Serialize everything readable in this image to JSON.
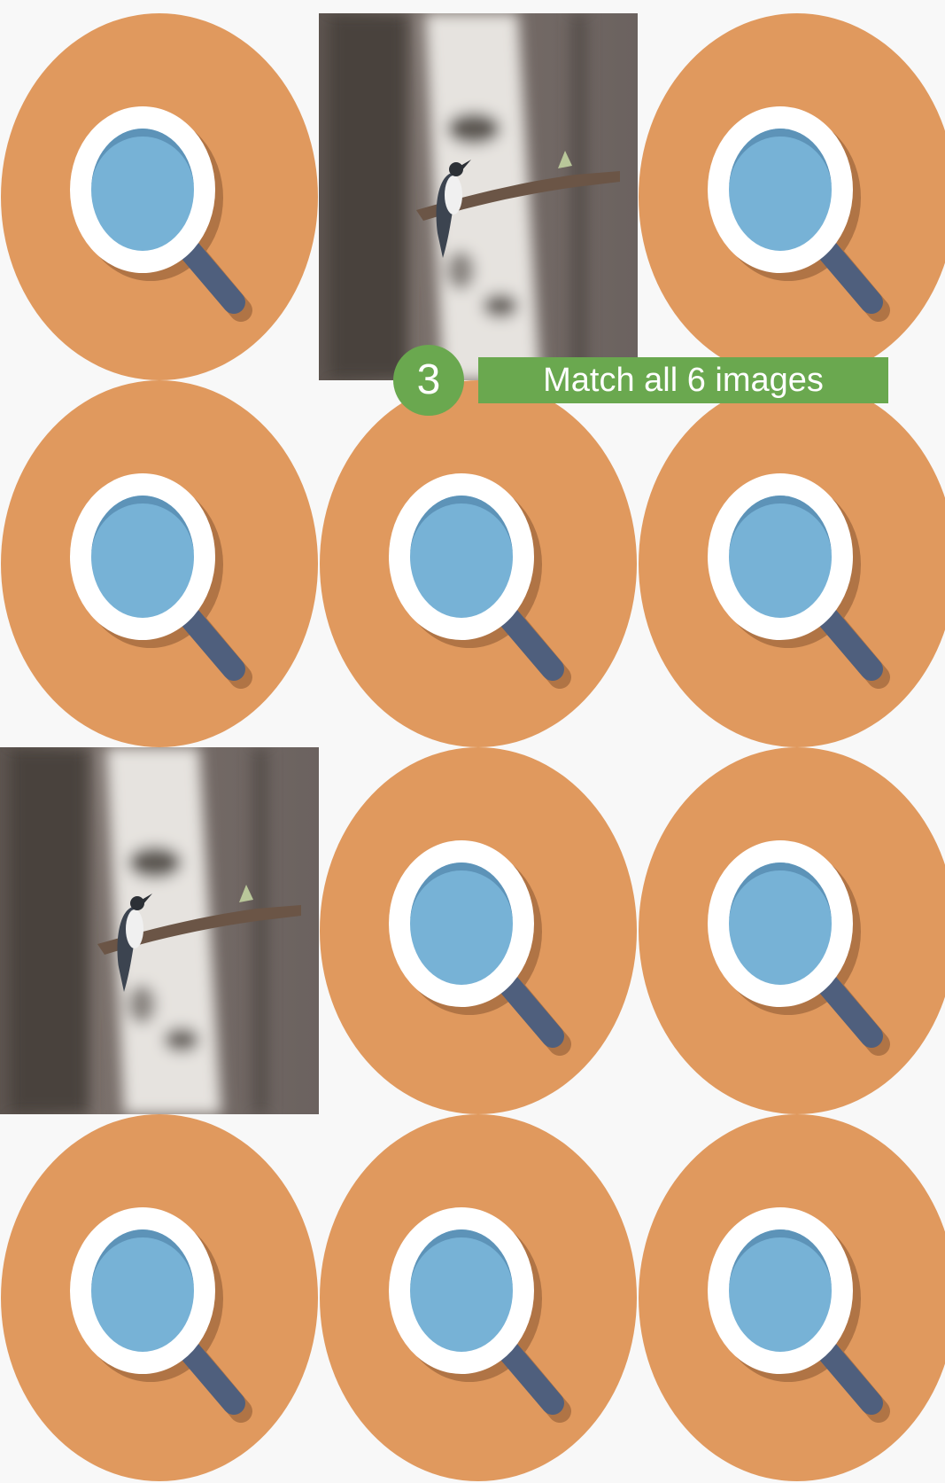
{
  "game": {
    "tries_count": "3",
    "instruction": "Match all 6 images"
  },
  "colors": {
    "page_background": "#f8f8f8",
    "card_back": "#e0995e",
    "lens_ring": "#ffffff",
    "lens_glass": "#77b2d6",
    "lens_shade": "#5d93b8",
    "handle": "#4f5f7d",
    "shadow": "#b07445",
    "status_green": "#6aa84f"
  },
  "board": {
    "columns": 3,
    "rows": 4,
    "cards": [
      {
        "state": "hidden",
        "icon": "magnifier-icon"
      },
      {
        "state": "revealed",
        "image": "nuthatch-on-branch-photo"
      },
      {
        "state": "hidden",
        "icon": "magnifier-icon"
      },
      {
        "state": "hidden",
        "icon": "magnifier-icon"
      },
      {
        "state": "hidden",
        "icon": "magnifier-icon"
      },
      {
        "state": "hidden",
        "icon": "magnifier-icon"
      },
      {
        "state": "revealed",
        "image": "nuthatch-on-branch-photo"
      },
      {
        "state": "hidden",
        "icon": "magnifier-icon"
      },
      {
        "state": "hidden",
        "icon": "magnifier-icon"
      },
      {
        "state": "hidden",
        "icon": "magnifier-icon"
      },
      {
        "state": "hidden",
        "icon": "magnifier-icon"
      },
      {
        "state": "hidden",
        "icon": "magnifier-icon"
      }
    ]
  }
}
